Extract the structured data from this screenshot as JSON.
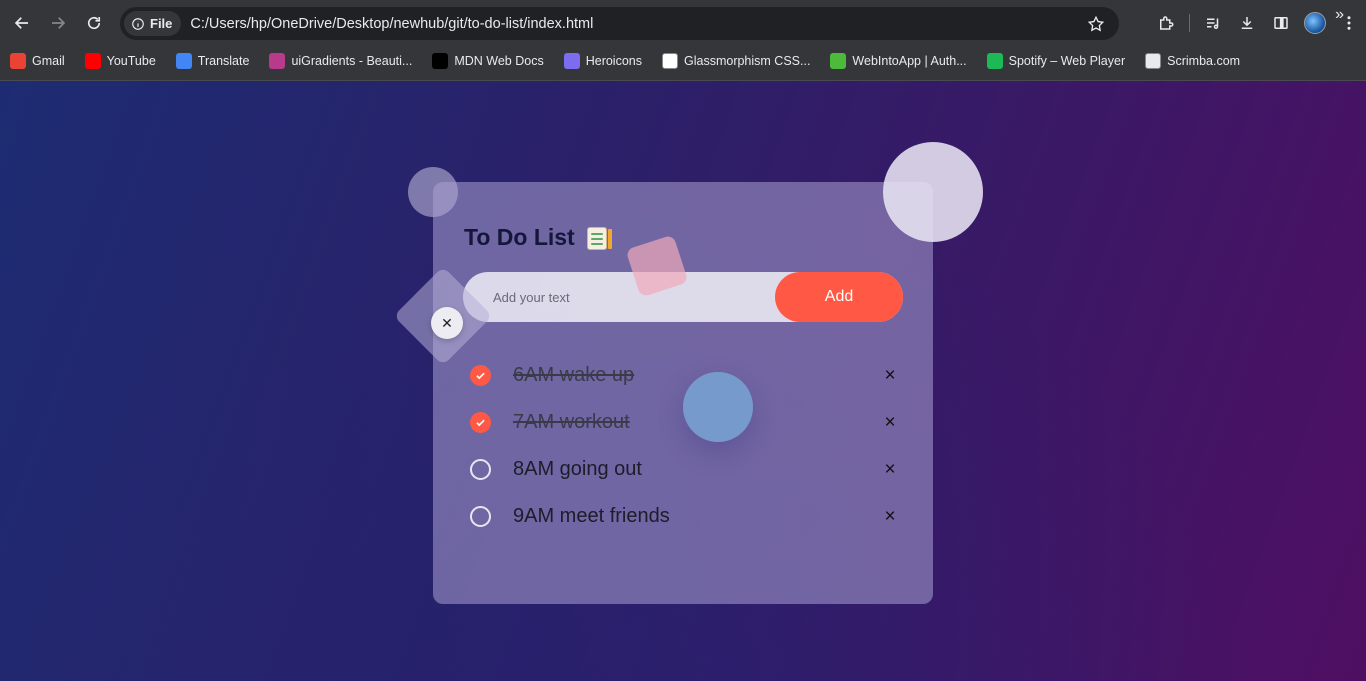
{
  "browser": {
    "site_chip_label": "File",
    "url": "C:/Users/hp/OneDrive/Desktop/newhub/git/to-do-list/index.html",
    "bookmarks": [
      {
        "label": "Gmail",
        "icon": "gmail-icon",
        "color": "#ea4335"
      },
      {
        "label": "YouTube",
        "icon": "youtube-icon",
        "color": "#ff0000"
      },
      {
        "label": "Translate",
        "icon": "translate-icon",
        "color": "#4285f4"
      },
      {
        "label": "uiGradients - Beauti...",
        "icon": "uigradients-icon",
        "color": "#b83a8a"
      },
      {
        "label": "MDN Web Docs",
        "icon": "mdn-icon",
        "color": "#000000"
      },
      {
        "label": "Heroicons",
        "icon": "heroicons-icon",
        "color": "#7c6cf0"
      },
      {
        "label": "Glassmorphism CSS...",
        "icon": "glassmorphism-icon",
        "color": "#ffffff"
      },
      {
        "label": "WebIntoApp | Auth...",
        "icon": "webintoapp-icon",
        "color": "#4cbb3c"
      },
      {
        "label": "Spotify – Web Player",
        "icon": "spotify-icon",
        "color": "#1db954"
      },
      {
        "label": "Scrimba.com",
        "icon": "scrimba-icon",
        "color": "#e8eaed"
      }
    ]
  },
  "app": {
    "title": "To Do List",
    "input_placeholder": "Add your text",
    "add_label": "Add",
    "accent": "#ff5945",
    "tasks": [
      {
        "text": "6AM wake up",
        "done": true
      },
      {
        "text": "7AM workout",
        "done": true
      },
      {
        "text": "8AM going out",
        "done": false
      },
      {
        "text": "9AM meet friends",
        "done": false
      }
    ],
    "delete_glyph": "×"
  }
}
